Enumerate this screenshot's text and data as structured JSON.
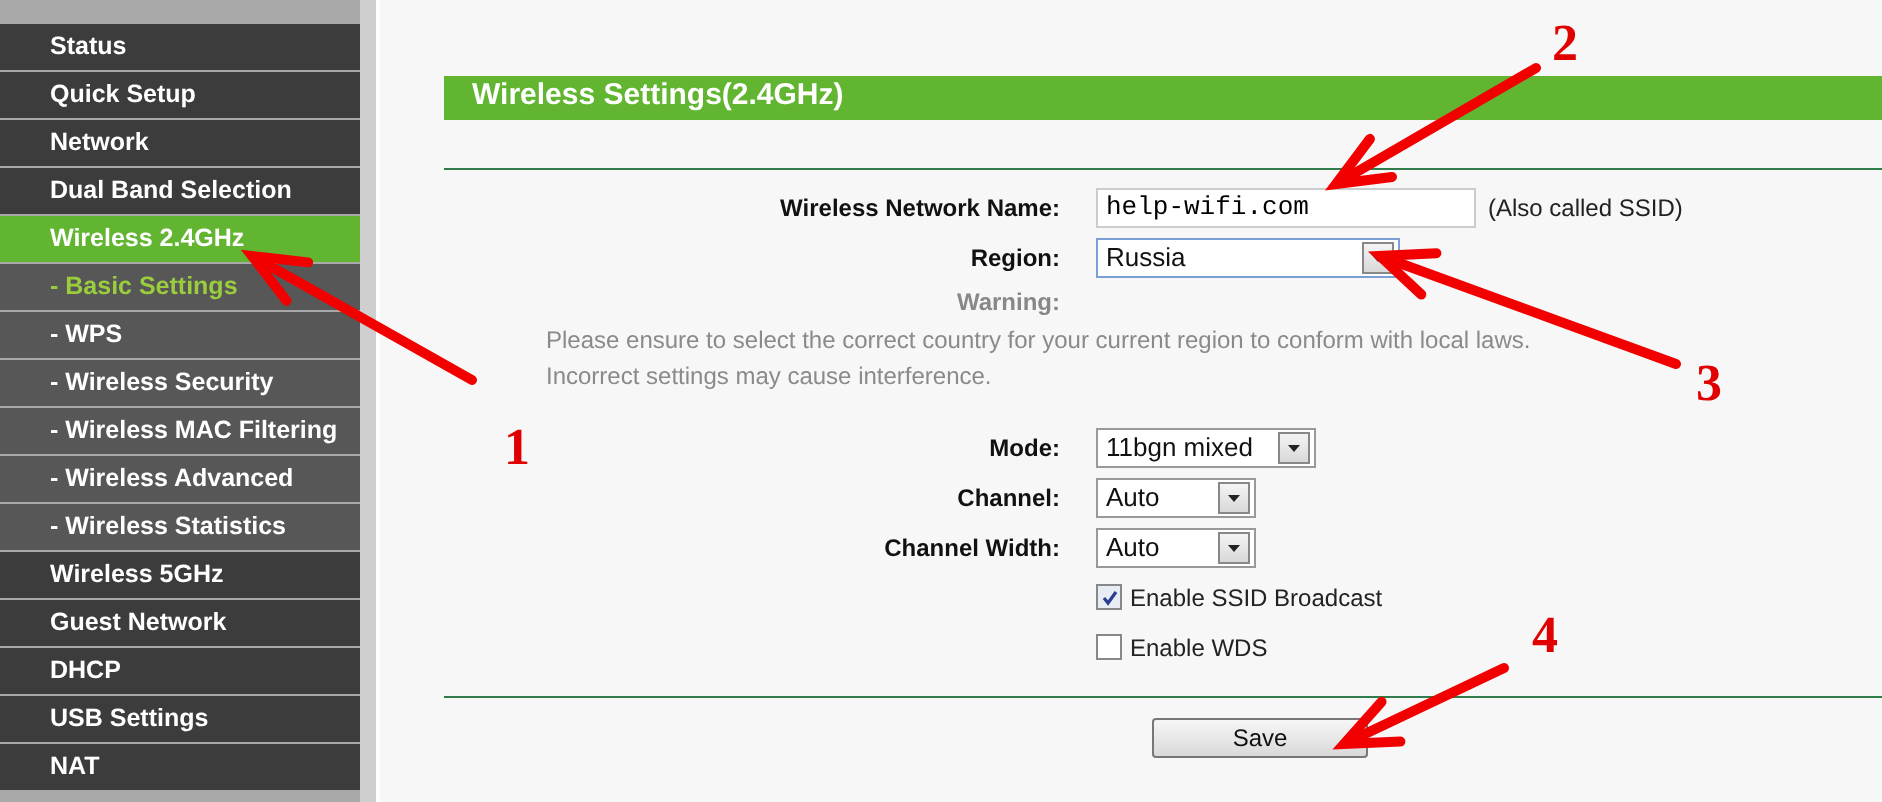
{
  "sidebar": {
    "items": [
      {
        "label": "Status",
        "kind": "main",
        "selected": false
      },
      {
        "label": "Quick Setup",
        "kind": "main",
        "selected": false
      },
      {
        "label": "Network",
        "kind": "main",
        "selected": false
      },
      {
        "label": "Dual Band Selection",
        "kind": "main",
        "selected": false
      },
      {
        "label": "Wireless 2.4GHz",
        "kind": "main",
        "selected": true
      },
      {
        "label": "- Basic Settings",
        "kind": "sub",
        "selected": true
      },
      {
        "label": "- WPS",
        "kind": "sub",
        "selected": false
      },
      {
        "label": "- Wireless Security",
        "kind": "sub",
        "selected": false
      },
      {
        "label": "- Wireless MAC Filtering",
        "kind": "sub",
        "selected": false
      },
      {
        "label": "- Wireless Advanced",
        "kind": "sub",
        "selected": false
      },
      {
        "label": "- Wireless Statistics",
        "kind": "sub",
        "selected": false
      },
      {
        "label": "Wireless 5GHz",
        "kind": "main",
        "selected": false
      },
      {
        "label": "Guest Network",
        "kind": "main",
        "selected": false
      },
      {
        "label": "DHCP",
        "kind": "main",
        "selected": false
      },
      {
        "label": "USB Settings",
        "kind": "main",
        "selected": false
      },
      {
        "label": "NAT",
        "kind": "main",
        "selected": false
      }
    ]
  },
  "panel": {
    "title": "Wireless Settings(2.4GHz)",
    "rows": [
      {
        "kind": "text",
        "label": "Wireless Network Name:",
        "value": "help-wifi.com",
        "note": "(Also called SSID)"
      },
      {
        "kind": "select",
        "label": "Region:",
        "value": "Russia"
      },
      {
        "kind": "warning",
        "label": "Warning:",
        "lines": [
          "Please ensure to select the correct country for your current region to conform with local laws.",
          "Incorrect settings may cause interference."
        ]
      },
      {
        "kind": "select",
        "label": "Mode:",
        "value": "11bgn mixed"
      },
      {
        "kind": "select",
        "label": "Channel:",
        "value": "Auto"
      },
      {
        "kind": "select",
        "label": "Channel Width:",
        "value": "Auto"
      },
      {
        "kind": "checkbox",
        "label": "Enable SSID Broadcast",
        "checked": true
      },
      {
        "kind": "checkbox",
        "label": "Enable WDS",
        "checked": false
      }
    ],
    "save_button": "Save"
  },
  "annotations": [
    {
      "label": "1"
    },
    {
      "label": "2"
    },
    {
      "label": "3"
    },
    {
      "label": "4"
    }
  ]
}
